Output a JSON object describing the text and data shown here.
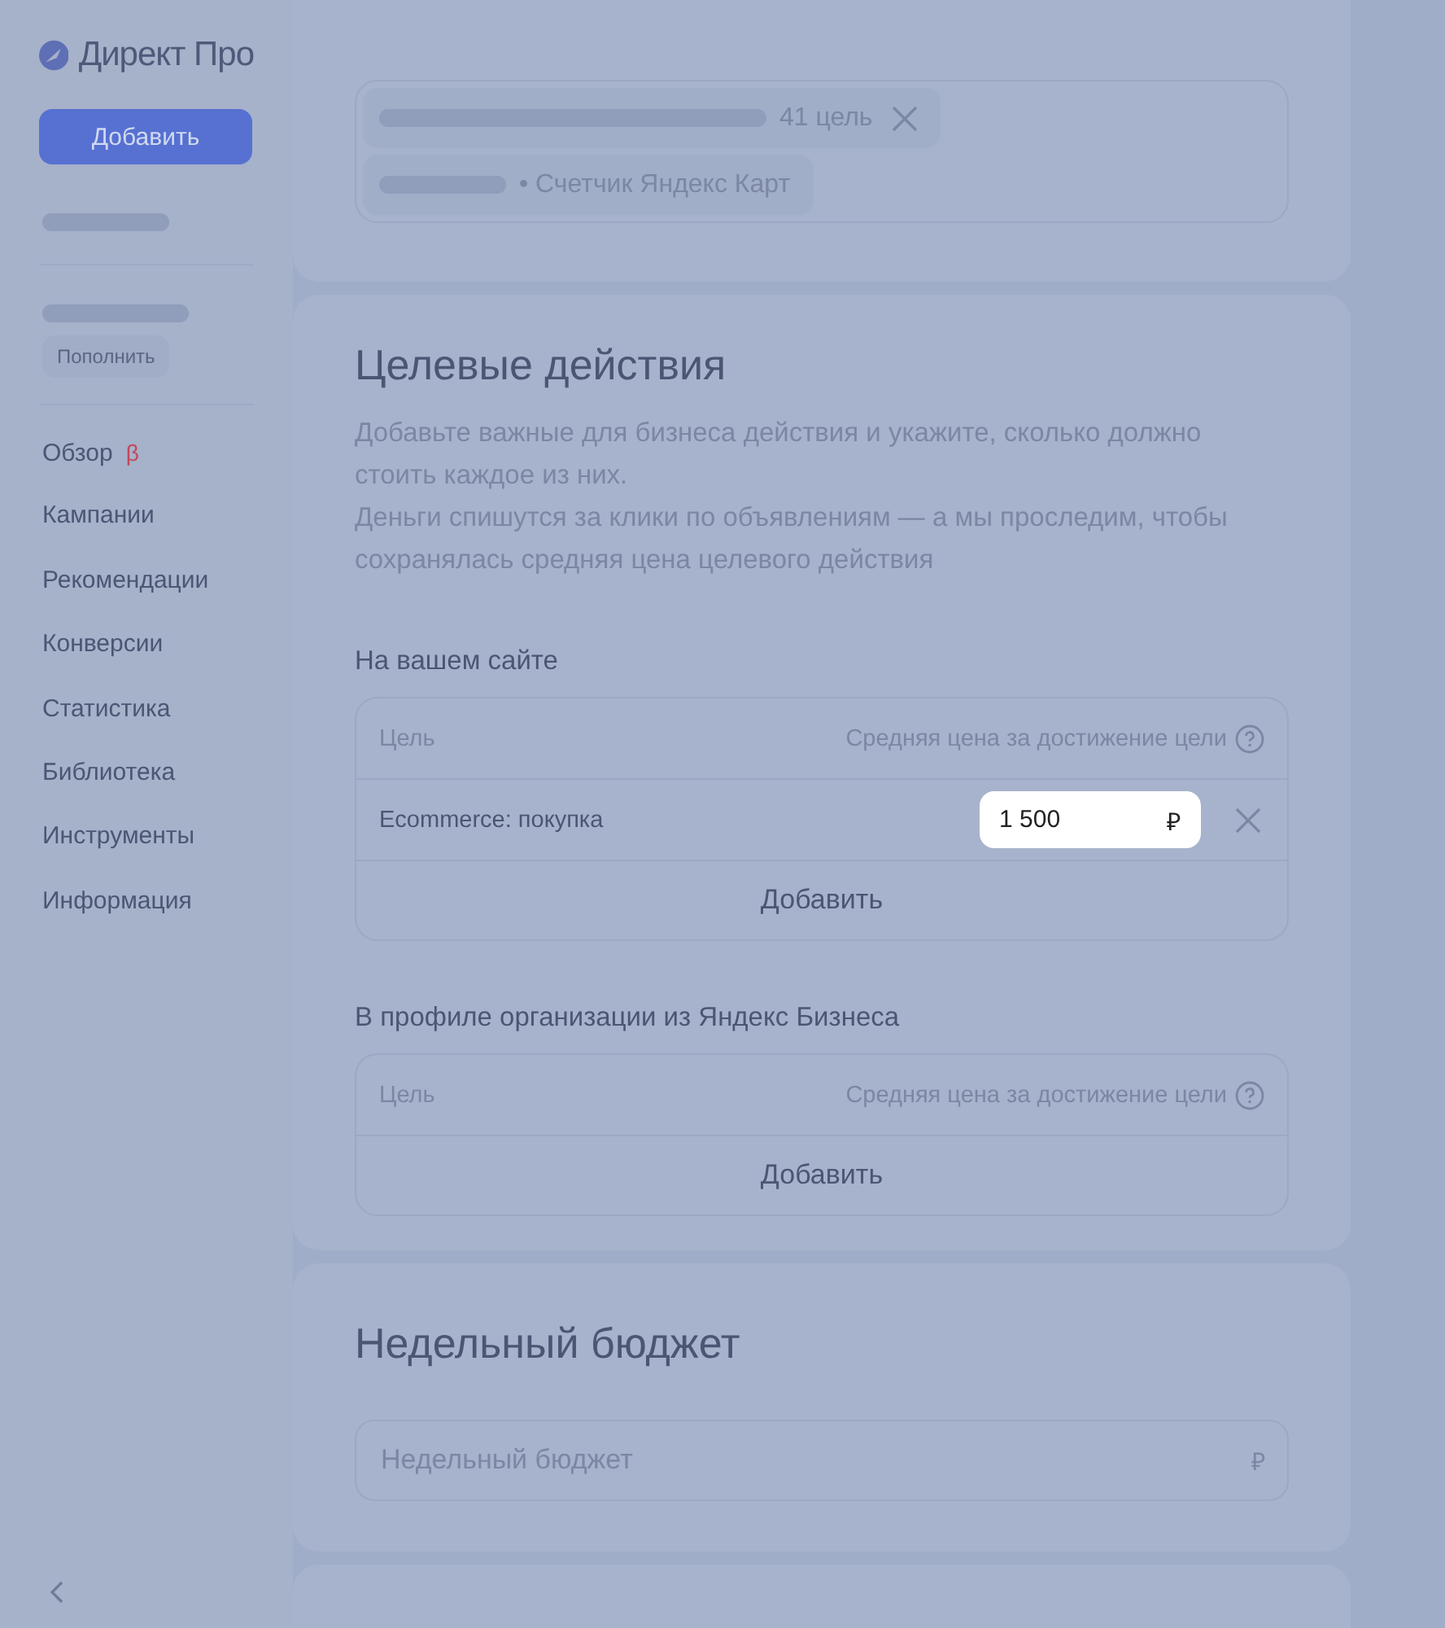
{
  "logo": {
    "text": "Директ Про"
  },
  "sidebar": {
    "add_button": "Добавить",
    "topup_button": "Пополнить",
    "nav": [
      {
        "label": "Обзор",
        "badge": "β"
      },
      {
        "label": "Кампании"
      },
      {
        "label": "Рекомендации"
      },
      {
        "label": "Конверсии"
      },
      {
        "label": "Статистика"
      },
      {
        "label": "Библиотека"
      },
      {
        "label": "Инструменты"
      },
      {
        "label": "Информация"
      }
    ]
  },
  "goals_card": {
    "chips": [
      {
        "kind": "removable",
        "text": "41 цель"
      },
      {
        "kind": "plain",
        "text": "• Счетчик Яндекс Карт"
      }
    ]
  },
  "target_actions": {
    "title": "Целевые действия",
    "description": [
      "Добавьте важные для бизнеса действия и укажите, сколько должно стоить каждое из них.",
      "Деньги спишутся за клики по объявлениям — а мы проследим, чтобы сохранялась средняя цена целевого действия"
    ],
    "sections": [
      {
        "title": "На вашем сайте",
        "columns": [
          "Цель",
          "Средняя цена за достижение цели"
        ],
        "rows": [
          {
            "goal": "Ecommerce: покупка",
            "price": "1 500",
            "currency": "₽"
          }
        ],
        "add_button": "Добавить"
      },
      {
        "title": "В профиле организации из Яндекс Бизнеса",
        "columns": [
          "Цель",
          "Средняя цена за достижение цели"
        ],
        "add_button": "Добавить"
      }
    ]
  },
  "budget": {
    "title": "Недельный бюджет",
    "placeholder": "Недельный бюджет",
    "currency": "₽"
  }
}
